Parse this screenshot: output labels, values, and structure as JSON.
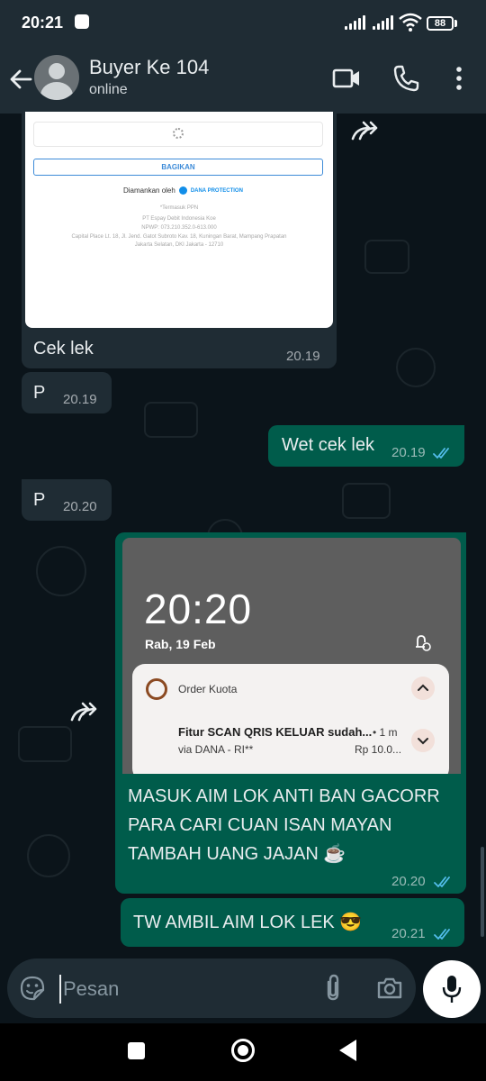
{
  "status_bar": {
    "time": "20:21",
    "battery": "88"
  },
  "header": {
    "contact_name": "Buyer Ke 104",
    "contact_status": "online"
  },
  "messages": [
    {
      "direction": "in",
      "type": "image",
      "image": {
        "share_label": "BAGIKAN",
        "secured_by": "Diamankan oleh",
        "secured_brand": "DANA PROTECTION",
        "vat_note": "*Termasuk PPN",
        "company": "PT Espay Debit Indonesia Koe",
        "npwp": "NPWP: 073.210.352.0-613.000",
        "address_1": "Capital Place Lt. 18, Jl. Jend. Gatot Subroto Kav. 18, Kuningan Barat, Mampang Prapatan",
        "address_2": "Jakarta Selatan, DKI Jakarta - 12710"
      },
      "text": "Cek lek",
      "time": "20.19"
    },
    {
      "direction": "in",
      "type": "text",
      "text": "P",
      "time": "20.19"
    },
    {
      "direction": "out",
      "type": "text",
      "text": "Wet cek lek",
      "time": "20.19",
      "status": "read"
    },
    {
      "direction": "in",
      "type": "text",
      "text": "P",
      "time": "20.20"
    },
    {
      "direction": "out",
      "type": "image",
      "image": {
        "lock_time": "20:20",
        "lock_date": "Rab, 19 Feb",
        "notif_app": "Order Kuota",
        "notif_title": "Fitur SCAN QRIS KELUAR sudah...",
        "notif_age": "• 1 m",
        "notif_sub": "via DANA - RI**",
        "notif_amount": "Rp 10.0..."
      },
      "text_lines": [
        "MASUK AIM LOK ANTI BAN GACORR",
        "PARA CARI CUAN ISAN MAYAN",
        "TAMBAH UANG JAJAN ☕"
      ],
      "time": "20.20",
      "status": "read"
    },
    {
      "direction": "out",
      "type": "text",
      "text": "TW AMBIL AIM LOK LEK 😎",
      "time": "20.21",
      "status": "read"
    }
  ],
  "composer": {
    "placeholder": "Pesan"
  },
  "colors": {
    "bg": "#0b141a",
    "incoming": "#1f2c34",
    "outgoing": "#005c4b",
    "read_tick": "#53bdeb"
  }
}
